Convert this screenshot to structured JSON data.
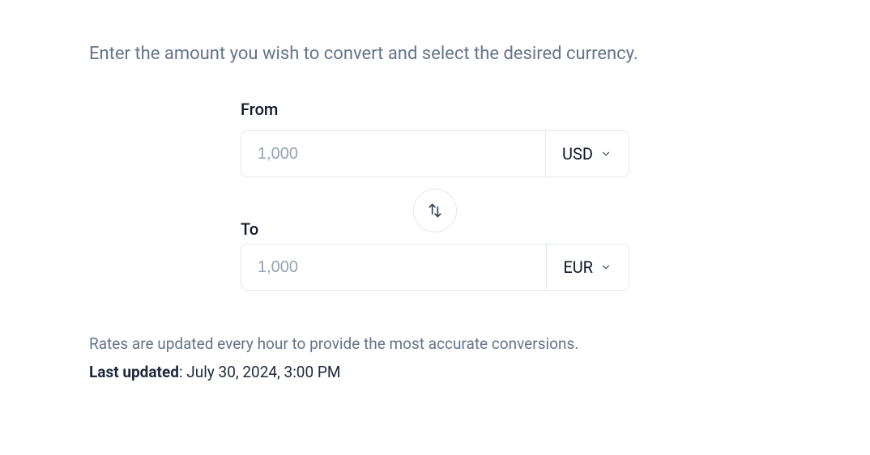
{
  "intro": "Enter the amount you wish to convert and select the desired currency.",
  "from": {
    "label": "From",
    "placeholder": "1,000",
    "value": "",
    "currency": "USD"
  },
  "to": {
    "label": "To",
    "placeholder": "1,000",
    "value": "",
    "currency": "EUR"
  },
  "footer": {
    "rates_note": "Rates are updated every hour to provide the most accurate conversions.",
    "last_updated_label": "Last updated",
    "last_updated_value": ": July 30, 2024, 3:00 PM"
  }
}
